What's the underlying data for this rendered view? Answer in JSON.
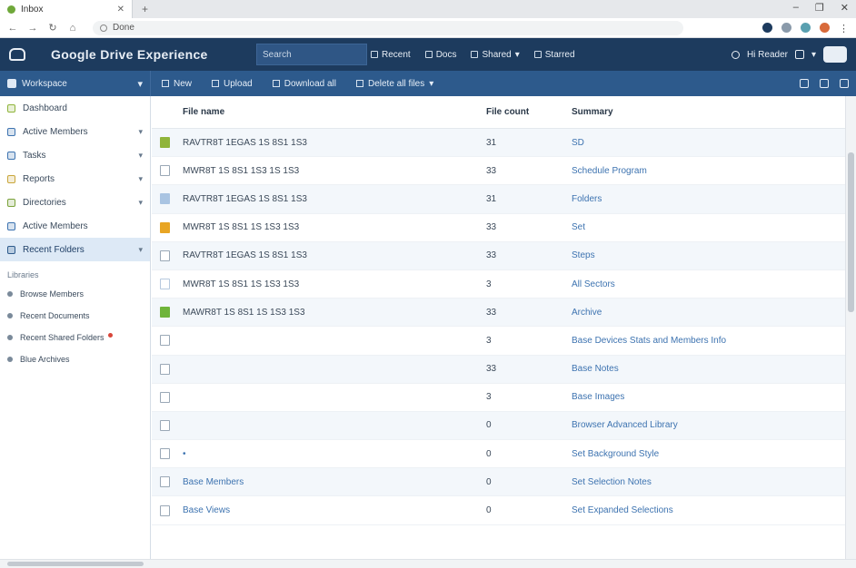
{
  "browser": {
    "tab_title": "Inbox",
    "url_value": "Done"
  },
  "header": {
    "brand": "Google Drive Experience",
    "search_placeholder": "Search",
    "nav": [
      {
        "label": "Recent",
        "icon": "clock-icon"
      },
      {
        "label": "Docs",
        "icon": "doc-icon"
      },
      {
        "label": "Shared",
        "icon": "share-icon"
      },
      {
        "label": "Starred",
        "icon": "star-icon"
      }
    ],
    "user_label": "Hi Reader"
  },
  "toolbar": {
    "workspace": "Workspace",
    "actions": [
      {
        "label": "New",
        "icon": "plus-icon"
      },
      {
        "label": "Upload",
        "icon": "upload-icon"
      },
      {
        "label": "Download all",
        "icon": "download-icon"
      },
      {
        "label": "Delete all files",
        "icon": "trash-icon"
      }
    ]
  },
  "sidebar": {
    "items": [
      {
        "label": "Dashboard",
        "color": "#8fb43a",
        "chevron": false,
        "active": false
      },
      {
        "label": "Active Members",
        "color": "#3d73b0",
        "chevron": true,
        "active": false
      },
      {
        "label": "Tasks",
        "color": "#3d73b0",
        "chevron": true,
        "active": false
      },
      {
        "label": "Reports",
        "color": "#c9a63a",
        "chevron": true,
        "active": false
      },
      {
        "label": "Directories",
        "color": "#7aa23a",
        "chevron": true,
        "active": false
      },
      {
        "label": "Active Members",
        "color": "#3d73b0",
        "chevron": false,
        "active": false
      },
      {
        "label": "Recent Folders",
        "color": "#2d5a8c",
        "chevron": true,
        "active": true
      }
    ],
    "group_label": "Libraries",
    "sub_items": [
      {
        "label": "Browse Members",
        "badge": false
      },
      {
        "label": "Recent Documents",
        "badge": false
      },
      {
        "label": "Recent Shared Folders",
        "badge": true
      },
      {
        "label": "Blue Archives",
        "badge": false
      }
    ]
  },
  "table": {
    "headers": {
      "name": "File name",
      "size": "File count",
      "summary": "Summary"
    },
    "rows": [
      {
        "icon": "gear-file-icon",
        "color": "#8fb43a",
        "name": "RAVTR8T 1EGAS 1S 8S1 1S3",
        "size": "31",
        "summary": "SD",
        "link": false
      },
      {
        "icon": "doc-file-icon",
        "color": "#9aa8b6",
        "name": "MWR8T 1S 8S1 1S3 1S 1S3",
        "size": "33",
        "summary": "Schedule Program",
        "link": false
      },
      {
        "icon": "image-file-icon",
        "color": "#a9c4e2",
        "name": "RAVTR8T 1EGAS 1S 8S1 1S3",
        "size": "31",
        "summary": "Folders",
        "link": false
      },
      {
        "icon": "folder-icon",
        "color": "#e8a524",
        "name": "MWR8T 1S 8S1 1S 1S3 1S3",
        "size": "33",
        "summary": "Set",
        "link": false
      },
      {
        "icon": "doc-file-icon",
        "color": "#9aa8b6",
        "name": "RAVTR8T 1EGAS 1S 8S1 1S3",
        "size": "33",
        "summary": "Steps",
        "link": false
      },
      {
        "icon": "doc-file-icon",
        "color": "#b7c9de",
        "name": "MWR8T 1S 8S1 1S 1S3 1S3",
        "size": "3",
        "summary": "All Sectors",
        "link": false
      },
      {
        "icon": "sheet-file-icon",
        "color": "#6fb43a",
        "name": "MAWR8T 1S 8S1 1S 1S3 1S3",
        "size": "33",
        "summary": "Archive",
        "link": false
      },
      {
        "icon": "blank-file-icon",
        "color": "#9aa8b6",
        "name": "",
        "size": "3",
        "summary": "Base Devices Stats and Members Info",
        "link": false
      },
      {
        "icon": "blank-file-icon",
        "color": "#9aa8b6",
        "name": "",
        "size": "33",
        "summary": "Base Notes",
        "link": false
      },
      {
        "icon": "blank-file-icon",
        "color": "#9aa8b6",
        "name": "",
        "size": "3",
        "summary": "Base Images",
        "link": false
      },
      {
        "icon": "blank-file-icon",
        "color": "#9aa8b6",
        "name": "",
        "size": "0",
        "summary": "Browser Advanced Library",
        "link": false
      },
      {
        "icon": "blank-file-icon",
        "color": "#9aa8b6",
        "name": "•",
        "size": "0",
        "summary": "Set Background Style",
        "link": true
      },
      {
        "icon": "person-file-icon",
        "color": "#9aa8b6",
        "name": "Base Members",
        "size": "0",
        "summary": "Set Selection Notes",
        "link": true
      },
      {
        "icon": "blank-file-icon",
        "color": "#9aa8b6",
        "name": "Base Views",
        "size": "0",
        "summary": "Set Expanded Selections",
        "link": true
      }
    ]
  }
}
